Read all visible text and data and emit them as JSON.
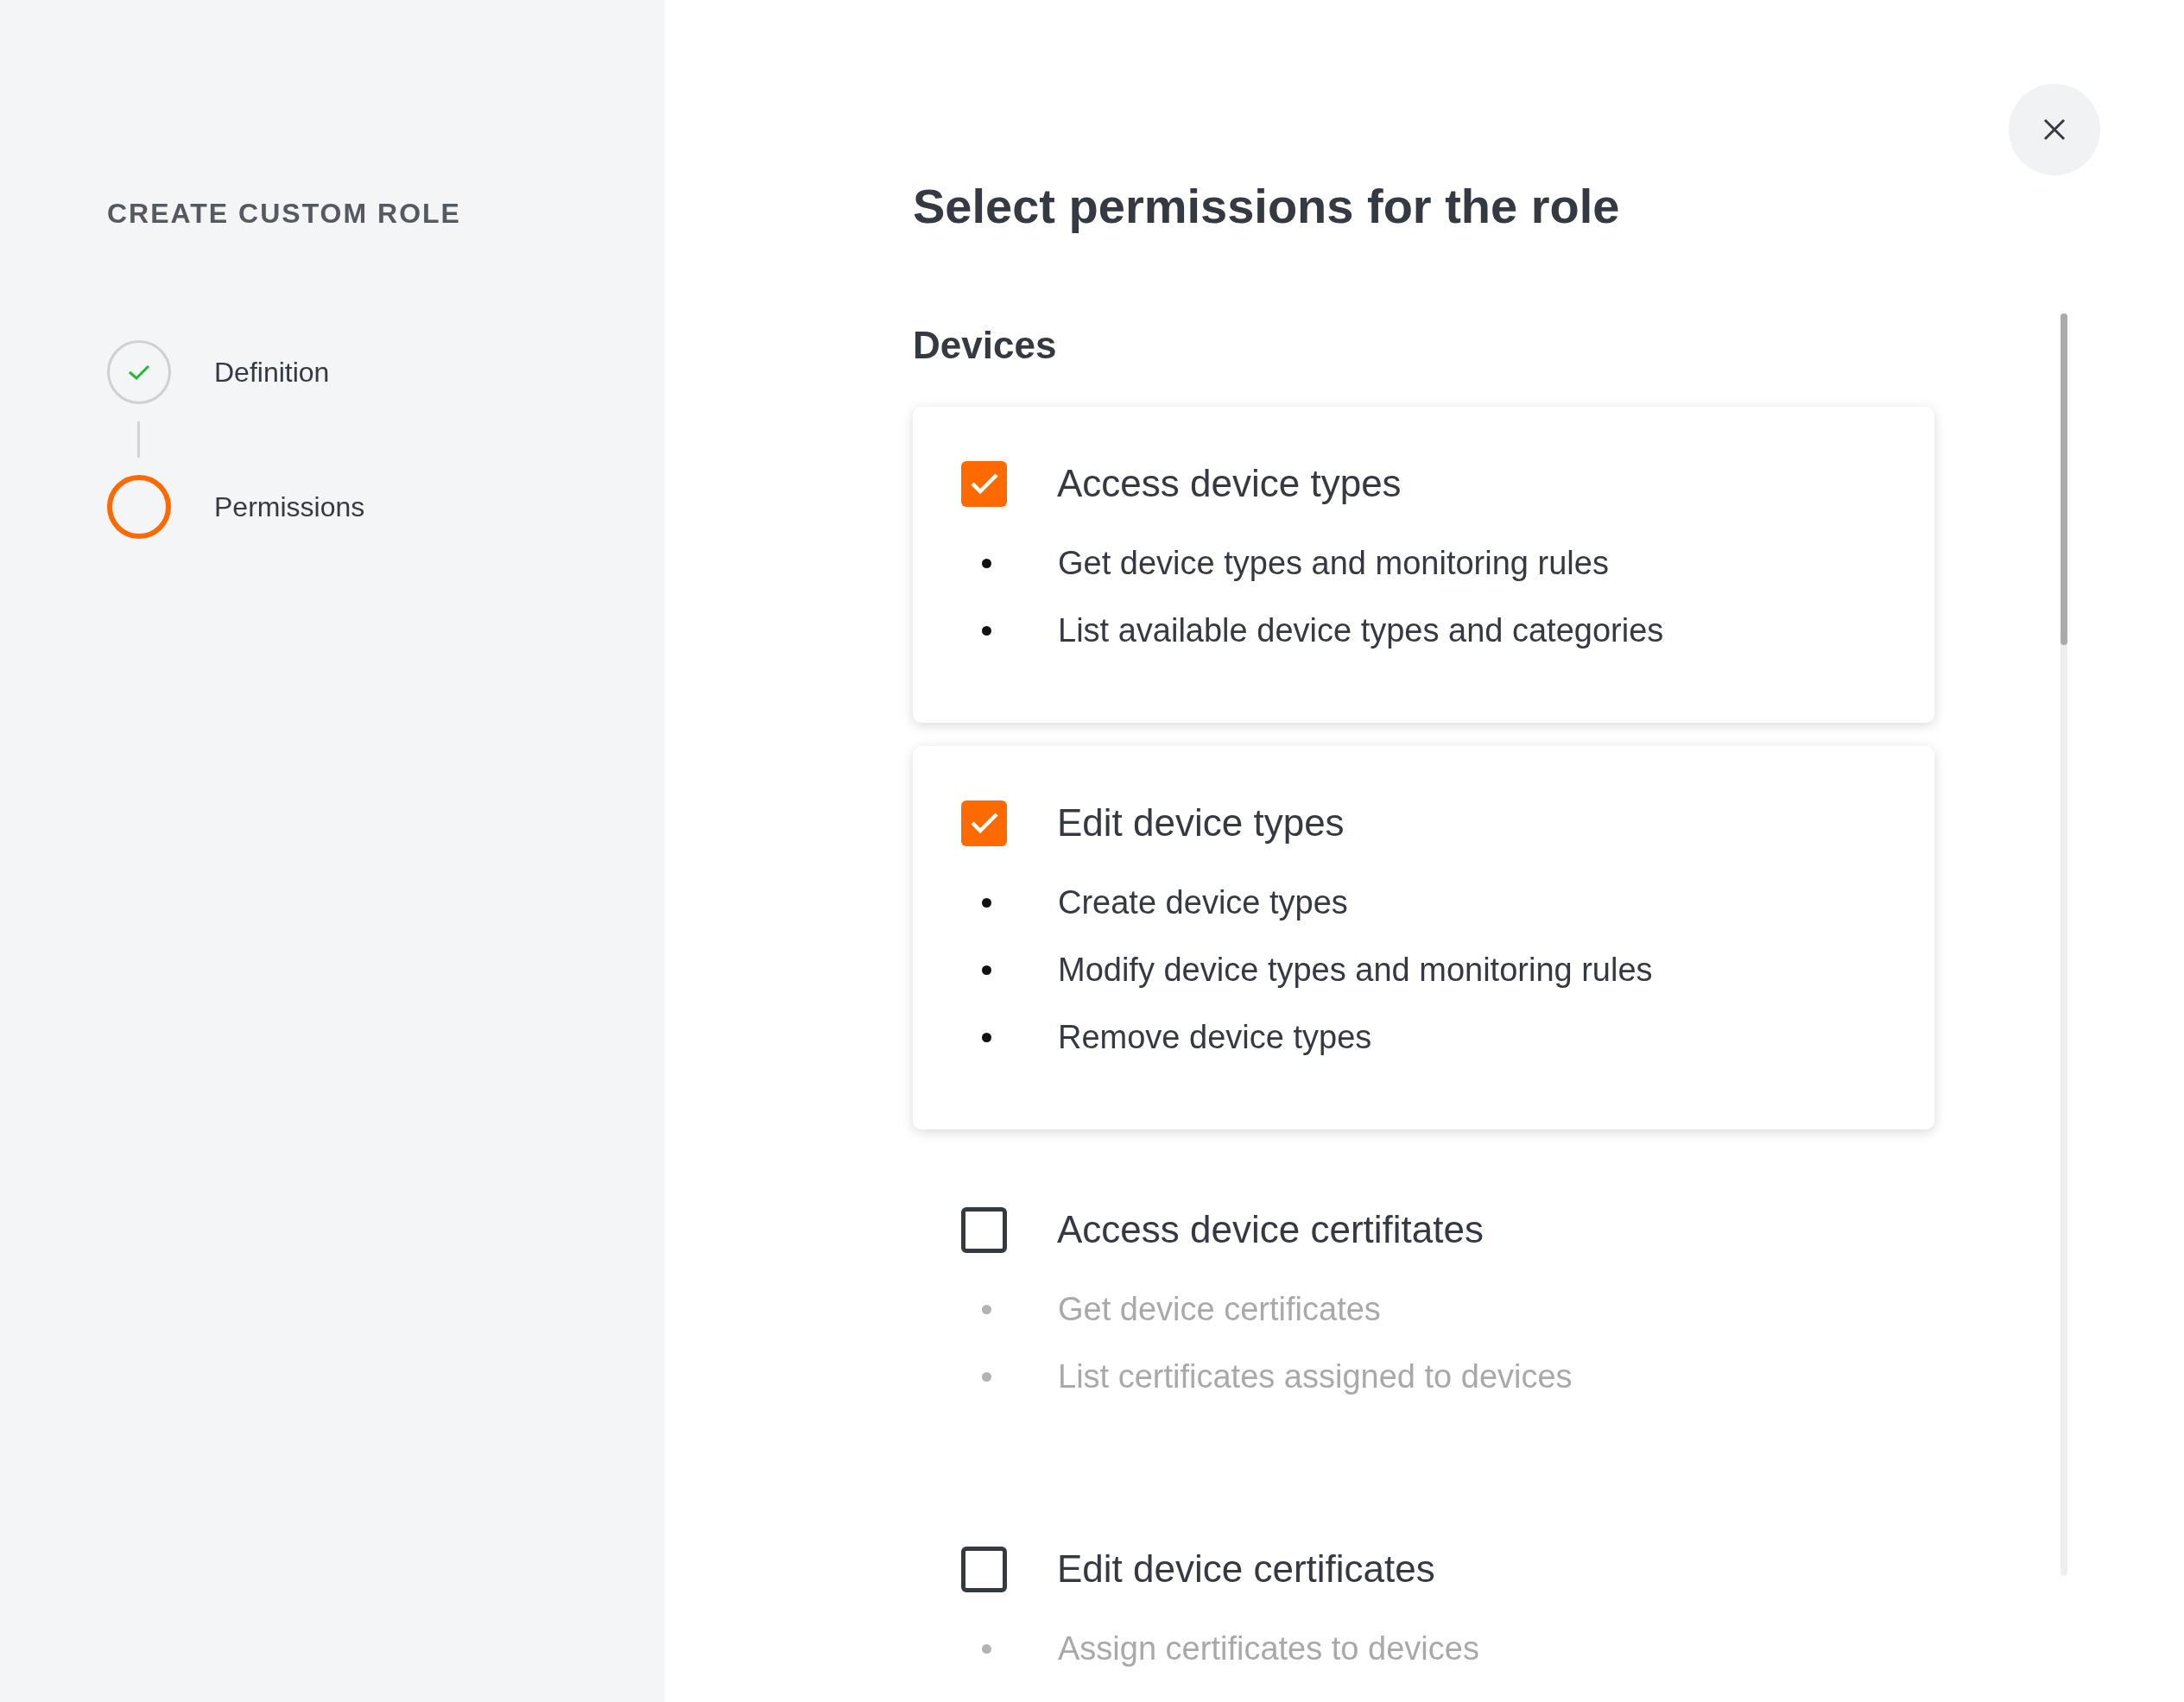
{
  "sidebar": {
    "title": "CREATE CUSTOM ROLE",
    "steps": [
      {
        "label": "Definition",
        "completed": true,
        "current": false
      },
      {
        "label": "Permissions",
        "completed": false,
        "current": true
      }
    ]
  },
  "main": {
    "heading": "Select permissions for the role",
    "sections": [
      {
        "title": "Devices",
        "permissions": [
          {
            "title": "Access device types",
            "checked": true,
            "details": [
              "Get device types and monitoring rules",
              "List available device types and categories"
            ]
          },
          {
            "title": "Edit device types",
            "checked": true,
            "details": [
              "Create device types",
              "Modify device types and monitoring rules",
              "Remove device types"
            ]
          },
          {
            "title": "Access device certifitates",
            "checked": false,
            "details": [
              "Get device certificates",
              "List certificates assigned to devices"
            ]
          },
          {
            "title": "Edit device certificates",
            "checked": false,
            "details": [
              "Assign certificates to devices"
            ]
          }
        ]
      }
    ]
  }
}
